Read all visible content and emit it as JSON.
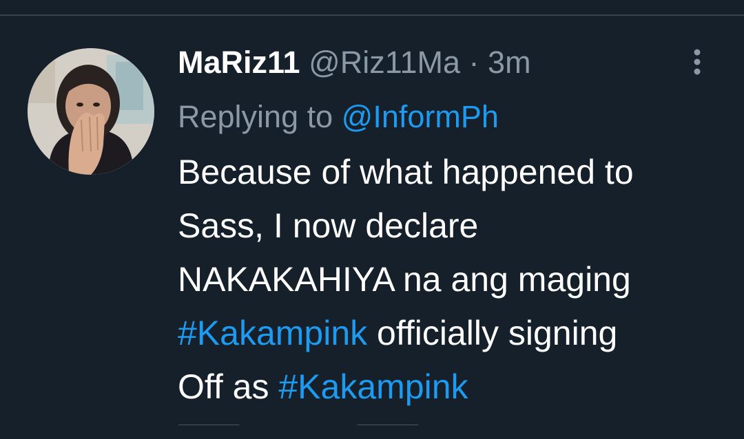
{
  "tweet": {
    "display_name": "MaRiz11",
    "handle": "@Riz11Ma",
    "separator": "·",
    "timestamp": "3m",
    "replying_prefix": "Replying to",
    "replying_to": "@InformPh",
    "text": {
      "line1": "Because of what happened to",
      "line2": "Sass, I now declare",
      "line3": "NAKAKAHIYA na ang maging",
      "hashtag1": "#Kakampink",
      "line4_rest": " officially signing",
      "line5_prefix": "Off as ",
      "hashtag2": "#Kakampink"
    },
    "more_icon": "more-vertical-icon"
  },
  "colors": {
    "background": "#15202b",
    "text_primary": "#ffffff",
    "text_secondary": "#8b98a5",
    "accent": "#1d9bf0",
    "divider": "#38444d"
  }
}
